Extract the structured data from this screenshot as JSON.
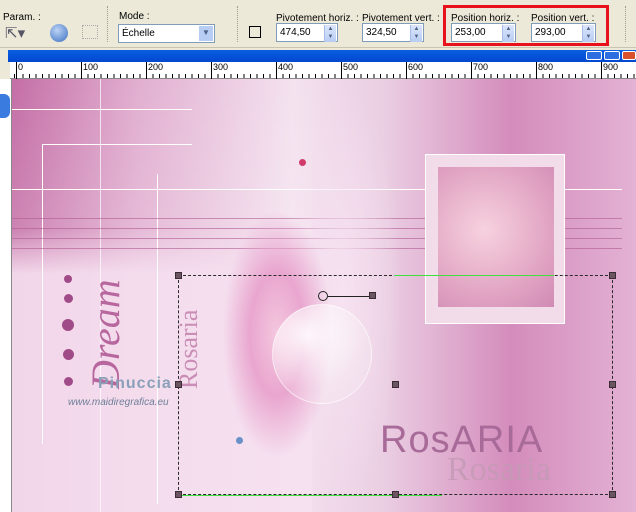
{
  "toolbar": {
    "param_label": "Param. :",
    "mode_label": "Mode :",
    "mode_value": "Échelle",
    "pivot_h_label": "Pivotement horiz. :",
    "pivot_h_value": "474,50",
    "pivot_v_label": "Pivotement vert. :",
    "pivot_v_value": "324,50",
    "pos_h_label": "Position horiz. :",
    "pos_h_value": "253,00",
    "pos_v_label": "Position vert. :",
    "pos_v_value": "293,00",
    "highlight_color": "#e8121c"
  },
  "ruler": {
    "ticks": [
      "0",
      "100",
      "200",
      "300",
      "400",
      "500",
      "600",
      "700",
      "800",
      "900"
    ]
  },
  "canvas": {
    "dream_text": "Dream",
    "signature": "Pinuccia",
    "url": "www.maidiregrafica.eu",
    "watermark_a": "Rosaria",
    "watermark_b": "Rosaria",
    "watermark_c": "RosARIA"
  }
}
